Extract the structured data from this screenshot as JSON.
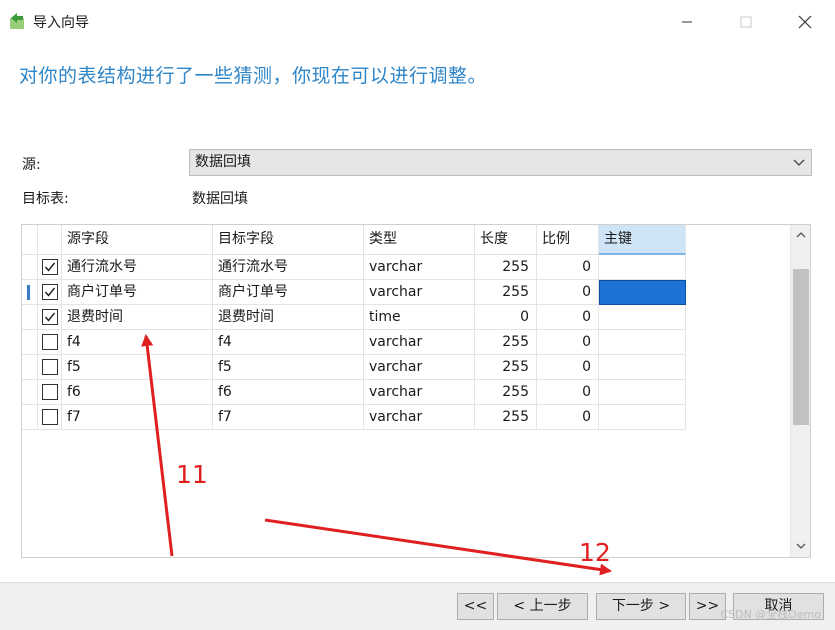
{
  "window": {
    "title": "导入向导"
  },
  "heading": "对你的表结构进行了一些猜测，你现在可以进行调整。",
  "source": {
    "label": "源:",
    "value": "数据回填"
  },
  "target": {
    "label": "目标表:",
    "value": "数据回填"
  },
  "grid": {
    "columns": {
      "source_field": "源字段",
      "target_field": "目标字段",
      "type": "类型",
      "length": "长度",
      "scale": "比例",
      "primary_key": "主键"
    },
    "rows": [
      {
        "checked": true,
        "source": "通行流水号",
        "target": "通行流水号",
        "type": "varchar",
        "length": "255",
        "scale": "0"
      },
      {
        "checked": true,
        "source": "商户订单号",
        "target": "商户订单号",
        "type": "varchar",
        "length": "255",
        "scale": "0"
      },
      {
        "checked": true,
        "source": "退费时间",
        "target": "退费时间",
        "type": "time",
        "length": "0",
        "scale": "0"
      },
      {
        "checked": false,
        "source": "f4",
        "target": "f4",
        "type": "varchar",
        "length": "255",
        "scale": "0"
      },
      {
        "checked": false,
        "source": "f5",
        "target": "f5",
        "type": "varchar",
        "length": "255",
        "scale": "0"
      },
      {
        "checked": false,
        "source": "f6",
        "target": "f6",
        "type": "varchar",
        "length": "255",
        "scale": "0"
      },
      {
        "checked": false,
        "source": "f7",
        "target": "f7",
        "type": "varchar",
        "length": "255",
        "scale": "0"
      }
    ],
    "selected_row": 1
  },
  "footer": {
    "first_label": "<<",
    "prev_label": "< 上一步",
    "next_label": "下一步 >",
    "last_label": ">>",
    "cancel_label": "取消"
  },
  "annotations": {
    "label_a": "11",
    "label_b": "12",
    "color": "#e02020"
  },
  "watermark": "CSDN @全栈Demo",
  "colors": {
    "heading": "#2f86c8",
    "selection": "#1e74d6",
    "pk_header": "#cfe4f7"
  }
}
